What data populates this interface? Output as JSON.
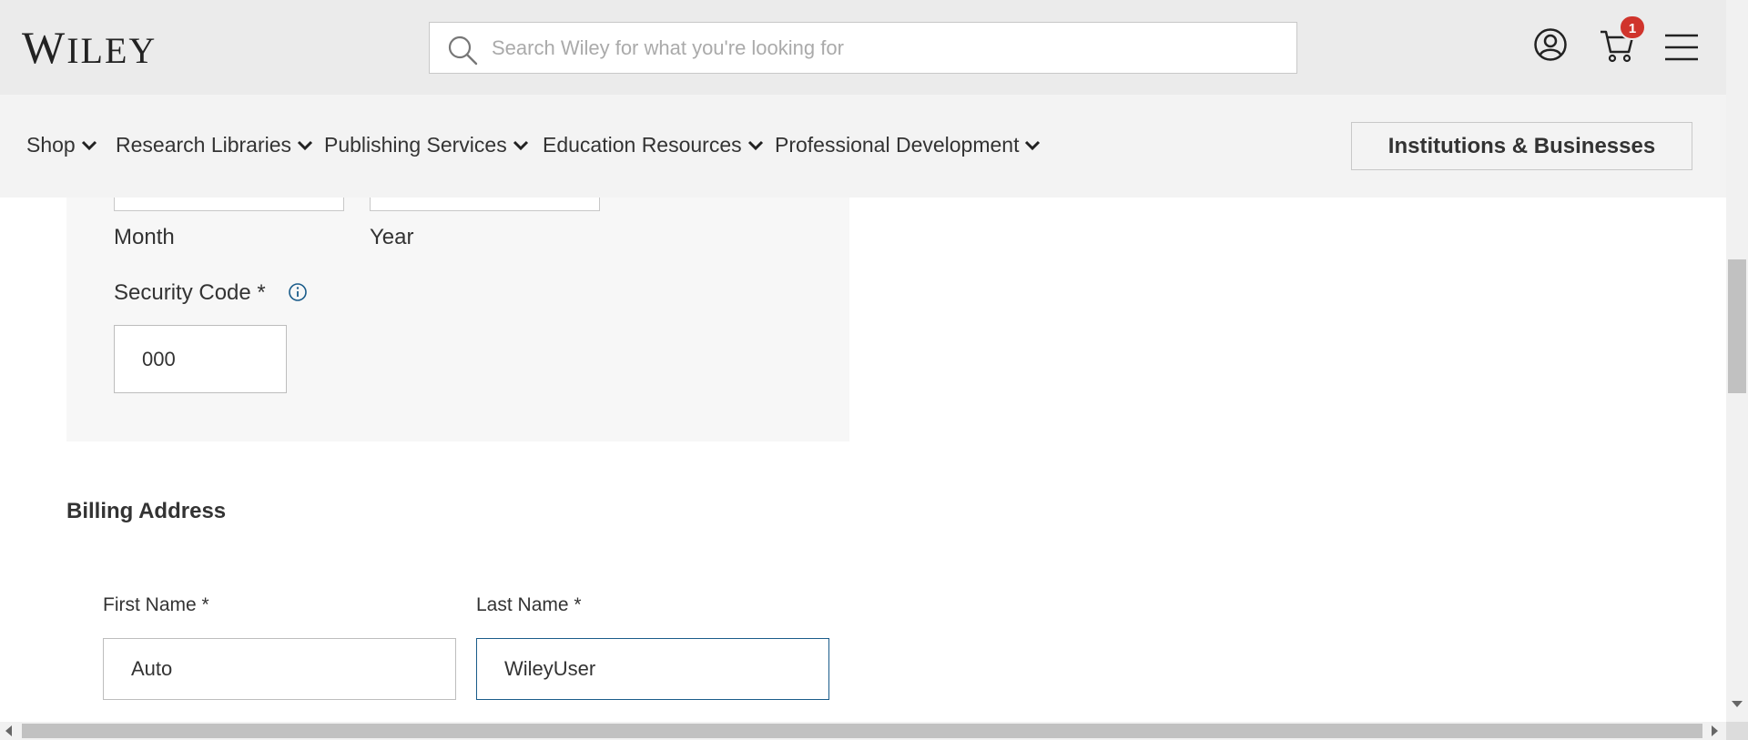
{
  "header": {
    "logo_text_big": "W",
    "logo_text_small": "ILEY",
    "search": {
      "placeholder": "Search Wiley for what you're looking for",
      "value": ""
    },
    "cart_count": "1"
  },
  "nav": {
    "items": [
      {
        "label": "Shop"
      },
      {
        "label": "Research Libraries"
      },
      {
        "label": "Publishing Services"
      },
      {
        "label": "Education Resources"
      },
      {
        "label": "Professional Development"
      }
    ],
    "institutions_button": "Institutions & Businesses"
  },
  "payment": {
    "month_label": "Month",
    "year_label": "Year",
    "security_code_label": "Security Code *",
    "security_code_value": "000"
  },
  "billing": {
    "heading": "Billing Address",
    "first_name_label": "First Name *",
    "first_name_value": "Auto",
    "last_name_label": "Last Name *",
    "last_name_value": "WileyUser"
  },
  "colors": {
    "header_bg": "#ebebeb",
    "nav_bg": "#f3f3f3",
    "badge": "#d0342c",
    "focus_border": "#1a5c8a"
  },
  "icons": [
    "search-icon",
    "account-icon",
    "cart-icon",
    "menu-icon",
    "chevron-down-icon",
    "info-icon"
  ]
}
